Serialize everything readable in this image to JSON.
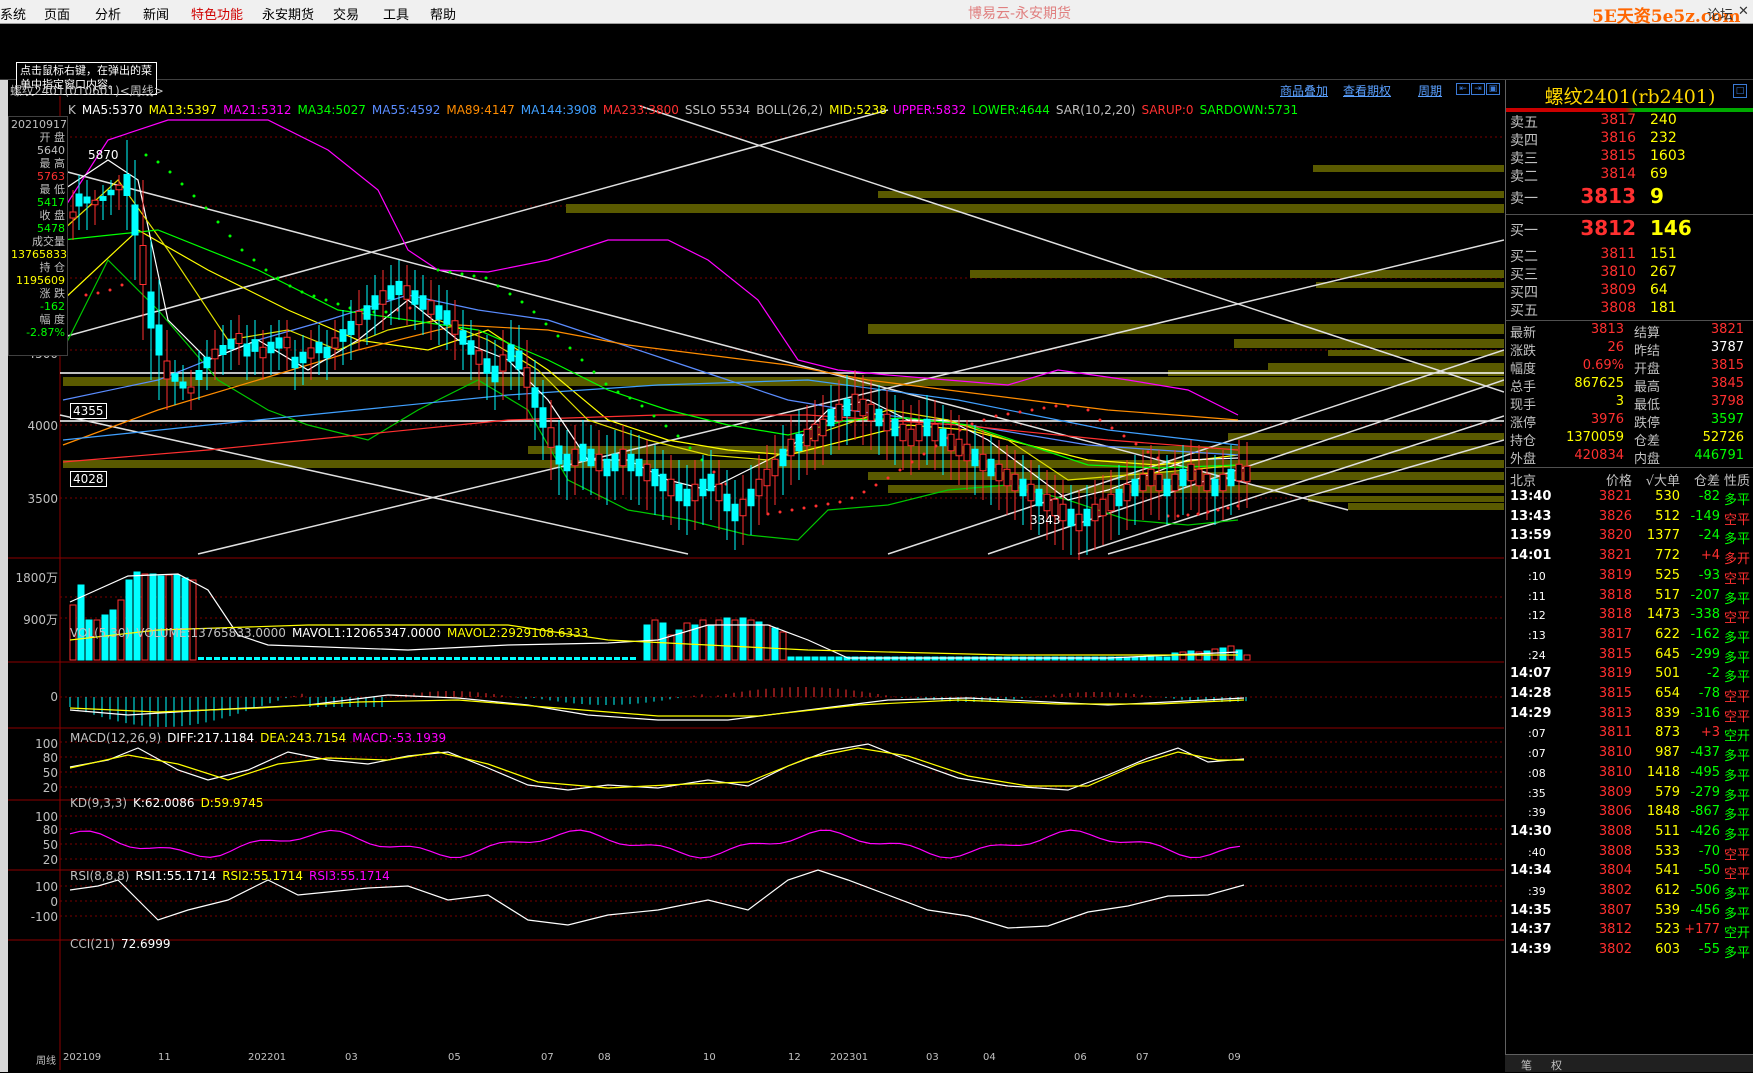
{
  "menu": {
    "items": [
      "系统",
      "页面",
      "分析",
      "新闻",
      "特色功能",
      "永安期货",
      "交易",
      "工具",
      "帮助"
    ],
    "active_index": 4,
    "app_title": "博易云-永安期货",
    "logo": "5E天资5e5z.com",
    "forum": "论坛"
  },
  "hint": "点击鼠标右键，在弹出的菜单中指定窗口内容。",
  "chart": {
    "symbol_title": "螺纹2401(010601)<周线>",
    "links": [
      "商品叠加",
      "查看期权",
      "周期"
    ],
    "ma_labels": [
      {
        "text": "K",
        "color": "#c0c0c0"
      },
      {
        "text": "MA5:5370",
        "color": "#ffffff"
      },
      {
        "text": "MA13:5397",
        "color": "#ffff00"
      },
      {
        "text": "MA21:5312",
        "color": "#ff00ff"
      },
      {
        "text": "MA34:5027",
        "color": "#00ff00"
      },
      {
        "text": "MA55:4592",
        "color": "#5a8cff"
      },
      {
        "text": "MA89:4147",
        "color": "#ff8c00"
      },
      {
        "text": "MA144:3908",
        "color": "#40a0ff"
      },
      {
        "text": "MA233:3800",
        "color": "#ff3030"
      },
      {
        "text": "SSLO 5534",
        "color": "#c0c0c0"
      },
      {
        "text": "BOLL(26,2)",
        "color": "#c0c0c0"
      },
      {
        "text": "MID:5238",
        "color": "#ffff00"
      },
      {
        "text": "UPPER:5832",
        "color": "#ff00ff"
      },
      {
        "text": "LOWER:4644",
        "color": "#00ff00"
      },
      {
        "text": "SAR(10,2,20)",
        "color": "#c0c0c0"
      },
      {
        "text": "SARUP:0",
        "color": "#ff3030"
      },
      {
        "text": "SARDOWN:5731",
        "color": "#00ff00"
      }
    ],
    "price_ticks": [
      "4500",
      "4000",
      "3500"
    ],
    "marked_levels": [
      "4355",
      "4028"
    ],
    "annotations": {
      "high": "5870",
      "low": "3343"
    },
    "info_panel": [
      {
        "label": "20210917",
        "value": ""
      },
      {
        "label": "开  盘",
        "value": "5640",
        "color": "#c0c0c0"
      },
      {
        "label": "最  高",
        "value": "5763",
        "color": "#ff3030"
      },
      {
        "label": "最  低",
        "value": "5417",
        "color": "#00ff00"
      },
      {
        "label": "收  盘",
        "value": "5478",
        "color": "#00ff00"
      },
      {
        "label": "成交量",
        "value": "13765833",
        "color": "#ffff00"
      },
      {
        "label": "持  仓",
        "value": "1195609",
        "color": "#ffff00"
      },
      {
        "label": "涨  跌",
        "value": "-162",
        "color": "#00ff00"
      },
      {
        "label": "幅  度",
        "value": "-2.87%",
        "color": "#00ff00"
      }
    ],
    "vol": {
      "labels": [
        {
          "text": "VOL(5,30)",
          "color": "#c0c0c0"
        },
        {
          "text": "VOLUME:13765833.0000",
          "color": "#c0c0c0"
        },
        {
          "text": "MAVOL1:12065347.0000",
          "color": "#ffffff"
        },
        {
          "text": "MAVOL2:2929108.6333",
          "color": "#ffff00"
        }
      ],
      "ticks": [
        "1800万",
        "900万"
      ]
    },
    "macd": {
      "labels": [
        {
          "text": "MACD(12,26,9)",
          "color": "#c0c0c0"
        },
        {
          "text": "DIFF:217.1184",
          "color": "#ffffff"
        },
        {
          "text": "DEA:243.7154",
          "color": "#ffff00"
        },
        {
          "text": "MACD:-53.1939",
          "color": "#ff00ff"
        }
      ],
      "ticks": [
        "0"
      ]
    },
    "kd": {
      "labels": [
        {
          "text": "KD(9,3,3)",
          "color": "#c0c0c0"
        },
        {
          "text": "K:62.0086",
          "color": "#ffffff"
        },
        {
          "text": "D:59.9745",
          "color": "#ffff00"
        }
      ],
      "ticks": [
        "100",
        "80",
        "50",
        "20"
      ]
    },
    "rsi": {
      "labels": [
        {
          "text": "RSI(8,8,8)",
          "color": "#c0c0c0"
        },
        {
          "text": "RSI1:55.1714",
          "color": "#ffffff"
        },
        {
          "text": "RSI2:55.1714",
          "color": "#ffff00"
        },
        {
          "text": "RSI3:55.1714",
          "color": "#ff00ff"
        }
      ],
      "ticks": [
        "100",
        "80",
        "50",
        "20"
      ]
    },
    "cci": {
      "labels": [
        {
          "text": "CCI(21)",
          "color": "#c0c0c0"
        },
        {
          "text": "72.6999",
          "color": "#ffffff"
        }
      ],
      "ticks": [
        "100",
        "0",
        "-100"
      ]
    },
    "time_axis": [
      "周线",
      "202109",
      "11",
      "202201",
      "03",
      "05",
      "07",
      "08",
      "10",
      "12",
      "202301",
      "03",
      "04",
      "06",
      "07",
      "09"
    ]
  },
  "quote": {
    "title": "螺纹2401(rb2401)",
    "asks": [
      {
        "label": "卖五",
        "price": "3817",
        "vol": "240"
      },
      {
        "label": "卖四",
        "price": "3816",
        "vol": "232"
      },
      {
        "label": "卖三",
        "price": "3815",
        "vol": "1603"
      },
      {
        "label": "卖二",
        "price": "3814",
        "vol": "69"
      },
      {
        "label": "卖一",
        "price": "3813",
        "vol": "9"
      }
    ],
    "bids": [
      {
        "label": "买一",
        "price": "3812",
        "vol": "146"
      },
      {
        "label": "买二",
        "price": "3811",
        "vol": "151"
      },
      {
        "label": "买三",
        "price": "3810",
        "vol": "267"
      },
      {
        "label": "买四",
        "price": "3809",
        "vol": "64"
      },
      {
        "label": "买五",
        "price": "3808",
        "vol": "181"
      }
    ],
    "stats": [
      {
        "l": "最新",
        "v": "3813",
        "c": "#ff3030",
        "l2": "结算",
        "v2": "3821",
        "c2": "#ff3030"
      },
      {
        "l": "涨跌",
        "v": "26",
        "c": "#ff3030",
        "l2": "昨结",
        "v2": "3787",
        "c2": "#ffffff"
      },
      {
        "l": "幅度",
        "v": "0.69%",
        "c": "#ff3030",
        "l2": "开盘",
        "v2": "3815",
        "c2": "#ff3030"
      },
      {
        "l": "总手",
        "v": "867625",
        "c": "#ffff00",
        "l2": "最高",
        "v2": "3845",
        "c2": "#ff3030"
      },
      {
        "l": "现手",
        "v": "3",
        "c": "#ffff00",
        "l2": "最低",
        "v2": "3798",
        "c2": "#ff3030"
      },
      {
        "l": "涨停",
        "v": "3976",
        "c": "#ff3030",
        "l2": "跌停",
        "v2": "3597",
        "c2": "#00ff00"
      },
      {
        "l": "持仓",
        "v": "1370059",
        "c": "#ffff00",
        "l2": "仓差",
        "v2": "52726",
        "c2": "#ffff00"
      },
      {
        "l": "外盘",
        "v": "420834",
        "c": "#ff3030",
        "l2": "内盘",
        "v2": "446791",
        "c2": "#00ff00"
      }
    ],
    "tick_header": {
      "time": "北京",
      "price": "价格",
      "vol": "√大单",
      "chg": "仓差",
      "type": "性质"
    },
    "ticks": [
      {
        "time": "13:40",
        "sub": false,
        "price": "3821",
        "pc": "#ff3030",
        "vol": "530",
        "chg": "-82",
        "type": "多平",
        "tc": "#00ff00"
      },
      {
        "time": "13:43",
        "sub": false,
        "price": "3826",
        "pc": "#ff3030",
        "vol": "512",
        "chg": "-149",
        "type": "空平",
        "tc": "#ff3030"
      },
      {
        "time": "13:59",
        "sub": false,
        "price": "3820",
        "pc": "#ff3030",
        "vol": "1377",
        "chg": "-24",
        "type": "多平",
        "tc": "#00ff00"
      },
      {
        "time": "14:01",
        "sub": false,
        "price": "3821",
        "pc": "#ff3030",
        "vol": "772",
        "chg": "+4",
        "type": "多开",
        "tc": "#ff3030"
      },
      {
        "time": ":10",
        "sub": true,
        "price": "3819",
        "pc": "#ff3030",
        "vol": "525",
        "chg": "-93",
        "type": "空平",
        "tc": "#ff3030"
      },
      {
        "time": ":11",
        "sub": true,
        "price": "3818",
        "pc": "#ff3030",
        "vol": "517",
        "chg": "-207",
        "type": "多平",
        "tc": "#00ff00"
      },
      {
        "time": ":12",
        "sub": true,
        "price": "3818",
        "pc": "#ff3030",
        "vol": "1473",
        "chg": "-338",
        "type": "空平",
        "tc": "#ff3030"
      },
      {
        "time": ":13",
        "sub": true,
        "price": "3817",
        "pc": "#ff3030",
        "vol": "622",
        "chg": "-162",
        "type": "多平",
        "tc": "#00ff00"
      },
      {
        "time": ":24",
        "sub": true,
        "price": "3815",
        "pc": "#ff3030",
        "vol": "645",
        "chg": "-299",
        "type": "多平",
        "tc": "#00ff00"
      },
      {
        "time": "14:07",
        "sub": false,
        "price": "3819",
        "pc": "#ff3030",
        "vol": "501",
        "chg": "-2",
        "type": "多平",
        "tc": "#00ff00"
      },
      {
        "time": "14:28",
        "sub": false,
        "price": "3815",
        "pc": "#ff3030",
        "vol": "654",
        "chg": "-78",
        "type": "空平",
        "tc": "#ff3030"
      },
      {
        "time": "14:29",
        "sub": false,
        "price": "3813",
        "pc": "#ff3030",
        "vol": "839",
        "chg": "-316",
        "type": "空平",
        "tc": "#ff3030"
      },
      {
        "time": ":07",
        "sub": true,
        "price": "3811",
        "pc": "#ff3030",
        "vol": "873",
        "chg": "+3",
        "type": "空开",
        "tc": "#00ff00"
      },
      {
        "time": ":07",
        "sub": true,
        "price": "3810",
        "pc": "#ff3030",
        "vol": "987",
        "chg": "-437",
        "type": "多平",
        "tc": "#00ff00"
      },
      {
        "time": ":08",
        "sub": true,
        "price": "3810",
        "pc": "#ff3030",
        "vol": "1418",
        "chg": "-495",
        "type": "多平",
        "tc": "#00ff00"
      },
      {
        "time": ":35",
        "sub": true,
        "price": "3809",
        "pc": "#ff3030",
        "vol": "579",
        "chg": "-279",
        "type": "多平",
        "tc": "#00ff00"
      },
      {
        "time": ":39",
        "sub": true,
        "price": "3806",
        "pc": "#ff3030",
        "vol": "1848",
        "chg": "-867",
        "type": "多平",
        "tc": "#00ff00"
      },
      {
        "time": "14:30",
        "sub": false,
        "price": "3808",
        "pc": "#ff3030",
        "vol": "511",
        "chg": "-426",
        "type": "多平",
        "tc": "#00ff00"
      },
      {
        "time": ":40",
        "sub": true,
        "price": "3808",
        "pc": "#ff3030",
        "vol": "533",
        "chg": "-70",
        "type": "空平",
        "tc": "#ff3030"
      },
      {
        "time": "14:34",
        "sub": false,
        "price": "3804",
        "pc": "#ff3030",
        "vol": "541",
        "chg": "-50",
        "type": "空平",
        "tc": "#ff3030"
      },
      {
        "time": ":39",
        "sub": true,
        "price": "3802",
        "pc": "#ff3030",
        "vol": "612",
        "chg": "-506",
        "type": "多平",
        "tc": "#00ff00"
      },
      {
        "time": "14:35",
        "sub": false,
        "price": "3807",
        "pc": "#ff3030",
        "vol": "539",
        "chg": "-456",
        "type": "多平",
        "tc": "#00ff00"
      },
      {
        "time": "14:37",
        "sub": false,
        "price": "3812",
        "pc": "#ff3030",
        "vol": "523",
        "chg": "+177",
        "type": "空开",
        "tc": "#00ff00"
      },
      {
        "time": "14:39",
        "sub": false,
        "price": "3802",
        "pc": "#ff3030",
        "vol": "603",
        "chg": "-55",
        "type": "多平",
        "tc": "#00ff00"
      }
    ],
    "bottom_tabs": [
      "笔",
      "权"
    ]
  }
}
